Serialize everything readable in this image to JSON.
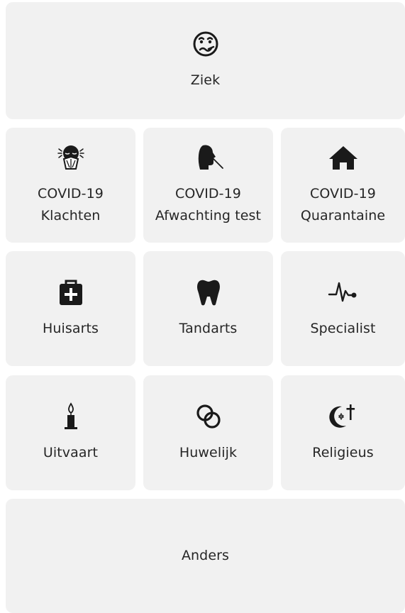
{
  "reasons": {
    "ziek": {
      "label": "Ziek",
      "icon": "sick-face-icon"
    },
    "covid_klachten": {
      "line1": "COVID-19",
      "line2": "Klachten",
      "icon": "sneezing-face-icon"
    },
    "covid_test": {
      "line1": "COVID-19",
      "line2": "Afwachting test",
      "icon": "nose-swab-test-icon"
    },
    "covid_quarantaine": {
      "line1": "COVID-19",
      "line2": "Quarantaine",
      "icon": "house-icon"
    },
    "huisarts": {
      "label": "Huisarts",
      "icon": "medical-kit-icon"
    },
    "tandarts": {
      "label": "Tandarts",
      "icon": "tooth-icon"
    },
    "specialist": {
      "label": "Specialist",
      "icon": "heartbeat-icon"
    },
    "uitvaart": {
      "label": "Uitvaart",
      "icon": "candle-icon"
    },
    "huwelijk": {
      "label": "Huwelijk",
      "icon": "rings-icon"
    },
    "religieus": {
      "label": "Religieus",
      "icon": "religious-symbols-icon"
    },
    "anders": {
      "label": "Anders"
    }
  },
  "colors": {
    "tile_background": "#f1f1f1",
    "text": "#262626",
    "icon": "#1a1a1a"
  }
}
